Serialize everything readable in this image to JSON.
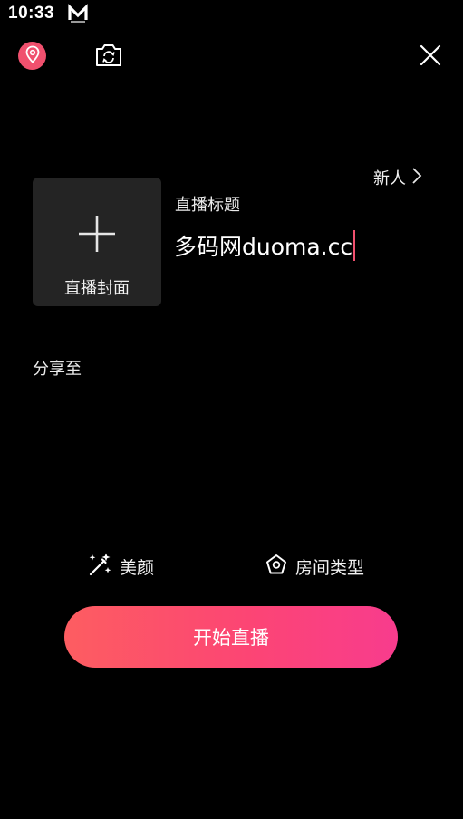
{
  "status_bar": {
    "time": "10:33",
    "app_icon": "m-app-icon"
  },
  "top_bar": {
    "location_icon": "location-pin-icon",
    "camera_icon": "camera-flip-icon",
    "close_icon": "close-icon"
  },
  "newcomer": {
    "label": "新人",
    "icon": "chevron-right-icon"
  },
  "cover": {
    "label": "直播封面",
    "icon": "plus-icon"
  },
  "title": {
    "label": "直播标题",
    "value": "多码网duoma.cc"
  },
  "share": {
    "label": "分享至"
  },
  "options": {
    "beauty_label": "美颜",
    "beauty_icon": "magic-wand-icon",
    "room_type_label": "房间类型",
    "room_type_icon": "pentagon-icon"
  },
  "start_button": {
    "label": "开始直播"
  },
  "colors": {
    "background": "#000000",
    "accent": "#f0506e",
    "card": "#242424",
    "button_gradient_start": "#fd5d61",
    "button_gradient_end": "#f83c8d"
  }
}
